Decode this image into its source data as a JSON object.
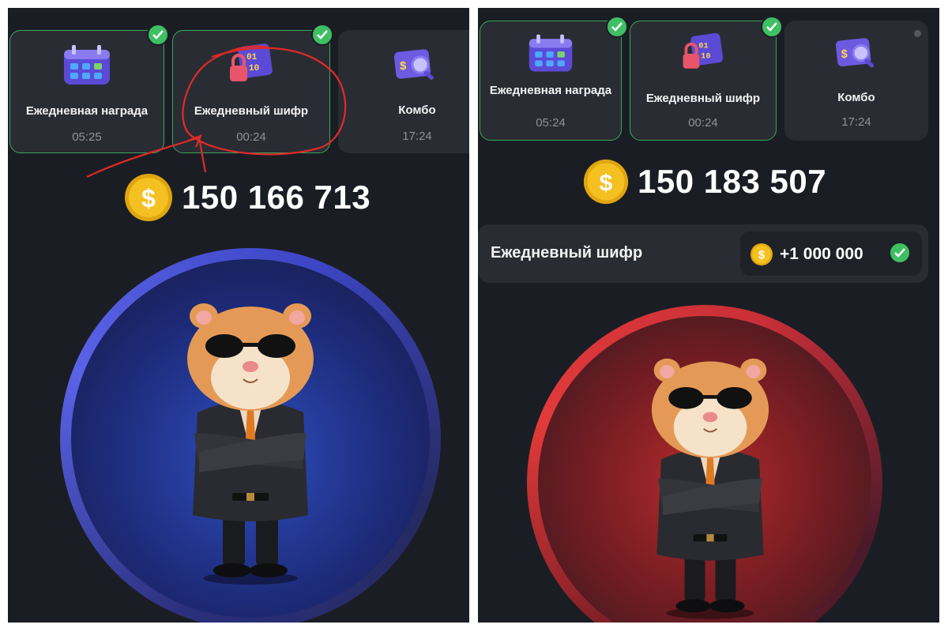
{
  "left": {
    "cards": [
      {
        "label": "Ежедневная награда",
        "time": "05:25",
        "icon": "calendar-icon",
        "completed": true
      },
      {
        "label": "Ежедневный шифр",
        "time": "00:24",
        "icon": "cipher-lock-icon",
        "completed": true
      },
      {
        "label": "Комбо",
        "time": "17:24",
        "icon": "combo-card-icon",
        "completed": false
      }
    ],
    "balance": "150 166 713",
    "ring_color": "#3f4fd1"
  },
  "right": {
    "cards": [
      {
        "label": "Ежедневная награда",
        "time": "05:24",
        "icon": "calendar-icon",
        "completed": true
      },
      {
        "label": "Ежедневный шифр",
        "time": "00:24",
        "icon": "cipher-lock-icon",
        "completed": true
      },
      {
        "label": "Комбо",
        "time": "17:24",
        "icon": "combo-card-icon",
        "completed": false
      }
    ],
    "balance": "150 183 507",
    "cipher_bar": {
      "label": "Ежедневный шифр",
      "reward": "+1 000 000",
      "claimed": true
    },
    "ring_color": "#e23a3a"
  },
  "colors": {
    "background": "#1b1d24",
    "card": "#2a2c33",
    "success": "#3fbf63",
    "coin": "#f5b914",
    "annotation": "#e02a2a"
  }
}
